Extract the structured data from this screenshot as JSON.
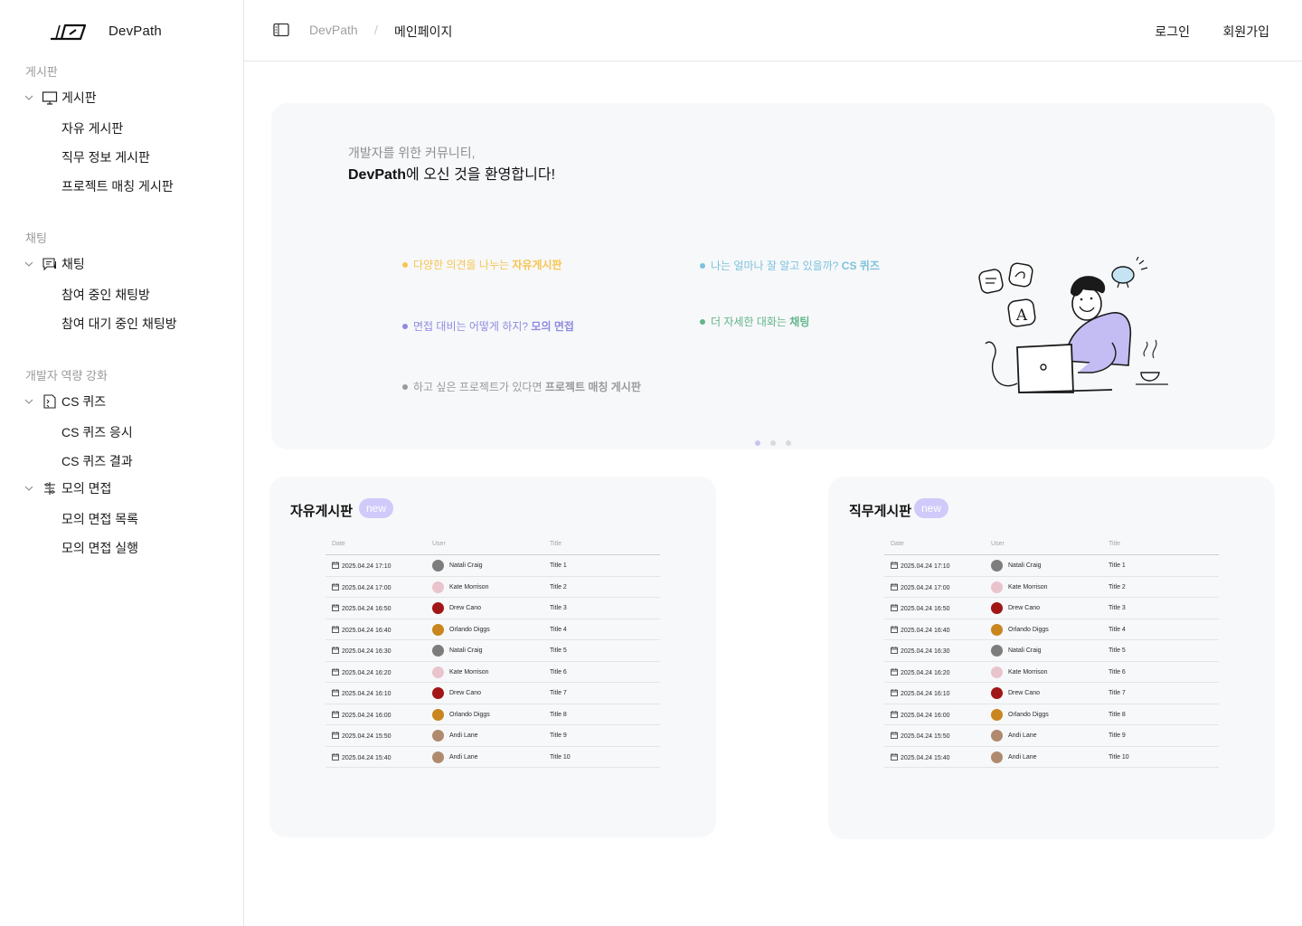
{
  "brand": {
    "name": "DevPath"
  },
  "sidebar": {
    "sections": [
      {
        "label": "게시판"
      },
      {
        "label": "채팅"
      },
      {
        "label": "개발자 역량 강화"
      }
    ],
    "groups": [
      {
        "label": "게시판",
        "icon": "monitor-icon",
        "items": [
          "자유 게시판",
          "직무 정보 게시판",
          "프로젝트 매칭 게시판"
        ]
      },
      {
        "label": "채팅",
        "icon": "chat-icon",
        "items": [
          "참여 중인 채팅방",
          "참여 대기 중인 채팅방"
        ]
      },
      {
        "label": "CS 퀴즈",
        "icon": "quiz-icon",
        "items": [
          "CS 퀴즈 응시",
          "CS 퀴즈 결과"
        ]
      },
      {
        "label": "모의 면접",
        "icon": "interview-icon",
        "items": [
          "모의 면접 목록",
          "모의 면접 실행"
        ]
      }
    ]
  },
  "header": {
    "breadcrumb_root": "DevPath",
    "breadcrumb_sep": "/",
    "breadcrumb_current": "메인페이지",
    "login": "로그인",
    "signup": "회원가입"
  },
  "hero": {
    "subtitle": "개발자를 위한 커뮤니티,",
    "title_bold": "DevPath",
    "title_rest": "에 오신 것을 환영합니다!",
    "features": [
      {
        "text": "다양한 의견을 나누는 ",
        "bold": "자유게시판",
        "color": "#f7c552"
      },
      {
        "text": "나는 얼마나 잘 알고 있을까? ",
        "bold": "CS 퀴즈",
        "color": "#7dc2dc"
      },
      {
        "text": "면접 대비는 어떻게 하지? ",
        "bold": "모의 면접",
        "color": "#8f8be0"
      },
      {
        "text": "더 자세한 대화는 ",
        "bold": "채팅",
        "color": "#63b58a"
      },
      {
        "text": "하고 싶은 프로젝트가 있다면 ",
        "bold": "프로젝트 매칭 게시판",
        "color": "#9a9a9a"
      }
    ],
    "pager_total": 3,
    "pager_active": 1
  },
  "boards": [
    {
      "title": "자유게시판",
      "badge": "new",
      "columns": [
        "Date",
        "User",
        "Title"
      ],
      "rows": [
        {
          "date": "2025.04.24 17:10",
          "user": "Natali Craig",
          "title": "Title 1",
          "avatar": "#7d7d7d"
        },
        {
          "date": "2025.04.24 17:00",
          "user": "Kate Morrison",
          "title": "Title 2",
          "avatar": "#e9c4cc"
        },
        {
          "date": "2025.04.24 16:50",
          "user": "Drew Cano",
          "title": "Title 3",
          "avatar": "#a11616"
        },
        {
          "date": "2025.04.24 16:40",
          "user": "Orlando Diggs",
          "title": "Title 4",
          "avatar": "#c9861e"
        },
        {
          "date": "2025.04.24 16:30",
          "user": "Natali Craig",
          "title": "Title 5",
          "avatar": "#7d7d7d"
        },
        {
          "date": "2025.04.24 16:20",
          "user": "Kate Morrison",
          "title": "Title 6",
          "avatar": "#e9c4cc"
        },
        {
          "date": "2025.04.24 16:10",
          "user": "Drew Cano",
          "title": "Title 7",
          "avatar": "#a11616"
        },
        {
          "date": "2025.04.24 16:00",
          "user": "Orlando Diggs",
          "title": "Title 8",
          "avatar": "#c9861e"
        },
        {
          "date": "2025.04.24 15:50",
          "user": "Andi Lane",
          "title": "Title 9",
          "avatar": "#b08a6e"
        },
        {
          "date": "2025.04.24 15:40",
          "user": "Andi Lane",
          "title": "Title 10",
          "avatar": "#b08a6e"
        }
      ]
    },
    {
      "title": "직무게시판",
      "badge": "new",
      "columns": [
        "Date",
        "User",
        "Title"
      ],
      "rows": [
        {
          "date": "2025.04.24 17:10",
          "user": "Natali Craig",
          "title": "Title 1",
          "avatar": "#7d7d7d"
        },
        {
          "date": "2025.04.24 17:00",
          "user": "Kate Morrison",
          "title": "Title 2",
          "avatar": "#e9c4cc"
        },
        {
          "date": "2025.04.24 16:50",
          "user": "Drew Cano",
          "title": "Title 3",
          "avatar": "#a11616"
        },
        {
          "date": "2025.04.24 16:40",
          "user": "Orlando Diggs",
          "title": "Title 4",
          "avatar": "#c9861e"
        },
        {
          "date": "2025.04.24 16:30",
          "user": "Natali Craig",
          "title": "Title 5",
          "avatar": "#7d7d7d"
        },
        {
          "date": "2025.04.24 16:20",
          "user": "Kate Morrison",
          "title": "Title 6",
          "avatar": "#e9c4cc"
        },
        {
          "date": "2025.04.24 16:10",
          "user": "Drew Cano",
          "title": "Title 7",
          "avatar": "#a11616"
        },
        {
          "date": "2025.04.24 16:00",
          "user": "Orlando Diggs",
          "title": "Title 8",
          "avatar": "#c9861e"
        },
        {
          "date": "2025.04.24 15:50",
          "user": "Andi Lane",
          "title": "Title 9",
          "avatar": "#b08a6e"
        },
        {
          "date": "2025.04.24 15:40",
          "user": "Andi Lane",
          "title": "Title 10",
          "avatar": "#b08a6e"
        }
      ]
    }
  ]
}
